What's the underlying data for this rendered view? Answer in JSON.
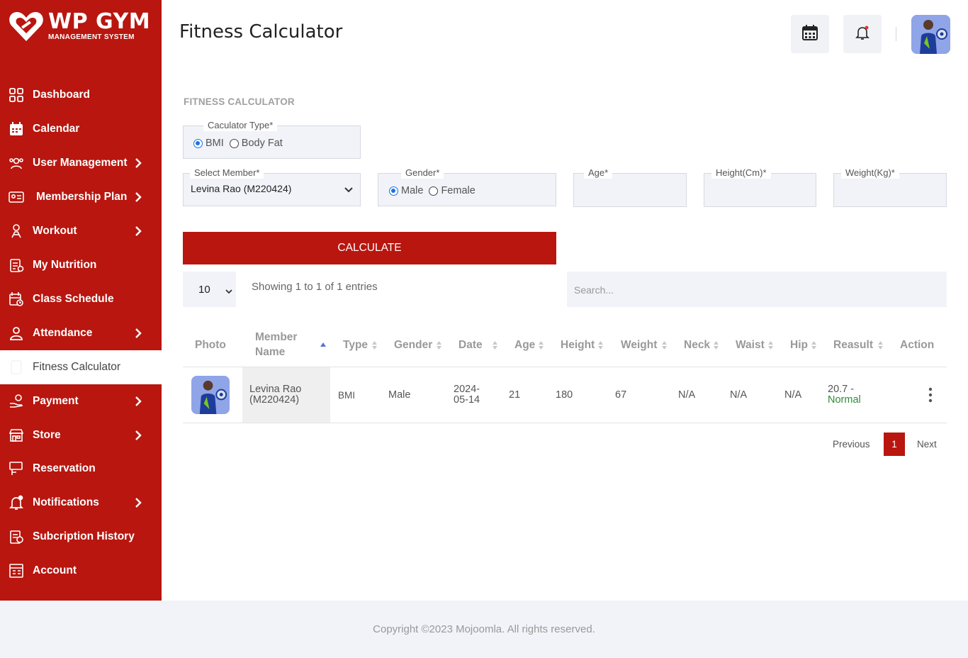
{
  "brand": {
    "title": "WP GYM",
    "subtitle": "MANAGEMENT SYSTEM",
    "color": "#b8160f"
  },
  "sidebar": {
    "items": [
      {
        "label": "Dashboard",
        "icon": "dashboard-grid-icon",
        "has_submenu": false,
        "active": false
      },
      {
        "label": "Calendar",
        "icon": "calendar-icon",
        "has_submenu": false,
        "active": false
      },
      {
        "label": "User Management",
        "icon": "users-gear-icon",
        "has_submenu": true,
        "active": false
      },
      {
        "label": "Membership Plan",
        "icon": "id-card-icon",
        "has_submenu": true,
        "active": false
      },
      {
        "label": "Workout",
        "icon": "workout-icon",
        "has_submenu": true,
        "active": false
      },
      {
        "label": "My Nutrition",
        "icon": "nutrition-clipboard-icon",
        "has_submenu": false,
        "active": false
      },
      {
        "label": "Class Schedule",
        "icon": "class-schedule-icon",
        "has_submenu": false,
        "active": false
      },
      {
        "label": "Attendance",
        "icon": "attendance-user-icon",
        "has_submenu": true,
        "active": false
      },
      {
        "label": "Fitness Calculator",
        "icon": "calculator-icon",
        "has_submenu": false,
        "active": true
      },
      {
        "label": "Payment",
        "icon": "payment-hand-icon",
        "has_submenu": true,
        "active": false
      },
      {
        "label": "Store",
        "icon": "store-icon",
        "has_submenu": true,
        "active": false
      },
      {
        "label": "Reservation",
        "icon": "reservation-icon",
        "has_submenu": false,
        "active": false
      },
      {
        "label": "Notifications",
        "icon": "bell-icon",
        "has_submenu": true,
        "active": false
      },
      {
        "label": "Subcription History",
        "icon": "history-document-icon",
        "has_submenu": false,
        "active": false
      },
      {
        "label": "Account",
        "icon": "account-icon",
        "has_submenu": false,
        "active": false
      }
    ]
  },
  "header": {
    "title": "Fitness Calculator"
  },
  "form": {
    "section_label": "FITNESS CALCULATOR",
    "calculator_type": {
      "label": "Caculator Type*",
      "options": [
        "BMI",
        "Body Fat"
      ],
      "selected": "BMI"
    },
    "member": {
      "label": "Select Member*",
      "value": "Levina Rao (M220424)"
    },
    "gender": {
      "label": "Gender*",
      "options": [
        "Male",
        "Female"
      ],
      "selected": "Male"
    },
    "age": {
      "label": "Age*",
      "value": ""
    },
    "height": {
      "label": "Height(Cm)*",
      "value": ""
    },
    "weight": {
      "label": "Weight(Kg)*",
      "value": ""
    },
    "calculate_label": "CALCULATE"
  },
  "table": {
    "page_length": "10",
    "info": "Showing 1 to 1 of 1 entries",
    "search_placeholder": "Search...",
    "headers": {
      "photo": "Photo",
      "member_name_1": "Member",
      "member_name_2": "Name",
      "type": "Type",
      "gender": "Gender",
      "date": "Date",
      "age": "Age",
      "height": "Height",
      "weight": "Weight",
      "neck": "Neck",
      "waist": "Waist",
      "hip": "Hip",
      "result": "Reasult",
      "action": "Action"
    },
    "rows": [
      {
        "name_1": "Levina Rao",
        "name_2": "(M220424)",
        "type": "BMI",
        "gender": "Male",
        "date_1": "2024-",
        "date_2": "05-14",
        "age": "21",
        "height": "180",
        "weight": "67",
        "neck": "N/A",
        "waist": "N/A",
        "hip": "N/A",
        "result_value": "20.7 -",
        "result_label": "Normal"
      }
    ],
    "pagination": {
      "previous": "Previous",
      "current": "1",
      "next": "Next"
    }
  },
  "footer": {
    "text": "Copyright ©2023 Mojoomla. All rights reserved."
  },
  "colors": {
    "accent": "#b8160f",
    "result_normal": "#2e8b3a",
    "sort_active": "#5b6fd6"
  }
}
